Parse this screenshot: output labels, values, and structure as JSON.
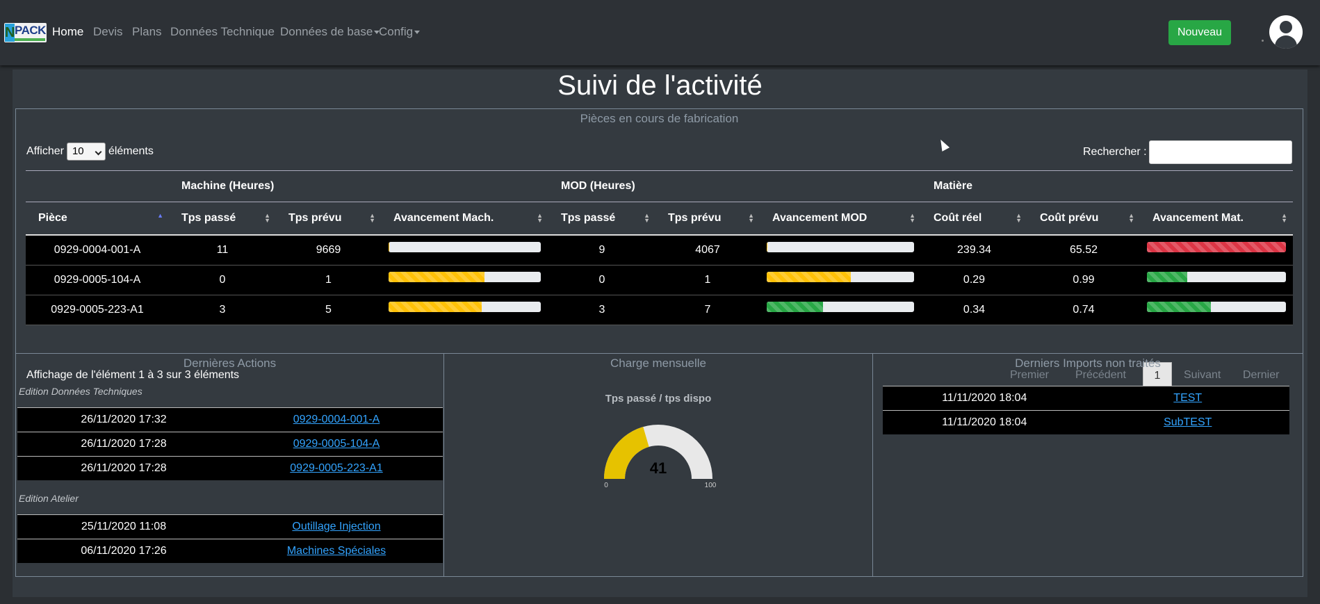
{
  "nav": {
    "logo_text": "PACK",
    "logo_letter": "N",
    "items": [
      {
        "label": "Home",
        "active": true
      },
      {
        "label": "Devis"
      },
      {
        "label": "Plans"
      },
      {
        "label": "Données Technique"
      },
      {
        "label": "Données de base",
        "dropdown": true
      },
      {
        "label": "Config",
        "dropdown": true
      }
    ],
    "new_button": "Nouveau",
    "avatar_icon": "user-circle-icon"
  },
  "page_title": "Suivi de l'activité",
  "pieces": {
    "title": "Pièces en cours de fabrication",
    "show_prefix": "Afficher",
    "show_value": "10",
    "show_suffix": "éléments",
    "search_label": "Rechercher :",
    "search_value": "",
    "groups": [
      "Machine (Heures)",
      "MOD (Heures)",
      "Matière"
    ],
    "columns": [
      "Pièce",
      "Tps passé",
      "Tps prévu",
      "Avancement Mach.",
      "Tps passé",
      "Tps prévu",
      "Avancement MOD",
      "Coût réel",
      "Coût prévu",
      "Avancement Mat."
    ],
    "rows": [
      {
        "piece": "0929-0004-001-A",
        "mach_passe": "11",
        "mach_prevu": "9669",
        "mach_pct": 0.11,
        "mod_passe": "9",
        "mod_prevu": "4067",
        "mod_pct": 0.22,
        "cout_reel": "239.34",
        "cout_prevu": "65.52",
        "mat_pct": 100
      },
      {
        "piece": "0929-0005-104-A",
        "mach_passe": "0",
        "mach_prevu": "1",
        "mach_pct": 63,
        "mod_passe": "0",
        "mod_prevu": "1",
        "mod_pct": 57,
        "cout_reel": "0.29",
        "cout_prevu": "0.99",
        "mat_pct": 29
      },
      {
        "piece": "0929-0005-223-A1",
        "mach_passe": "3",
        "mach_prevu": "5",
        "mach_pct": 61,
        "mod_passe": "3",
        "mod_prevu": "7",
        "mod_pct": 38,
        "cout_reel": "0.34",
        "cout_prevu": "0.74",
        "mat_pct": 46
      }
    ],
    "info": "Affichage de l'élément 1 à 3 sur 3 éléments",
    "pagination": {
      "first": "Premier",
      "prev": "Précédent",
      "current": "1",
      "next": "Suivant",
      "last": "Dernier"
    }
  },
  "actions": {
    "title": "Dernières Actions",
    "sections": [
      {
        "name": "Edition Données Techniques",
        "rows": [
          {
            "date": "26/11/2020 17:32",
            "link": "0929-0004-001-A"
          },
          {
            "date": "26/11/2020 17:28",
            "link": "0929-0005-104-A"
          },
          {
            "date": "26/11/2020 17:28",
            "link": "0929-0005-223-A1"
          }
        ]
      },
      {
        "name": "Edition Atelier",
        "rows": [
          {
            "date": "25/11/2020 11:08",
            "link": "Outillage Injection"
          },
          {
            "date": "06/11/2020 17:26",
            "link": "Machines Spéciales"
          }
        ]
      }
    ]
  },
  "charge": {
    "title": "Charge mensuelle",
    "gauge_title": "Tps passé / tps dispo",
    "value": 41,
    "min": "0",
    "max": "100",
    "fill_color": "#e6c200",
    "track_color": "#e8e8e8"
  },
  "imports": {
    "title": "Derniers Imports non traités",
    "rows": [
      {
        "date": "11/11/2020 18:04",
        "link": "TEST"
      },
      {
        "date": "11/11/2020 18:04",
        "link": "SubTEST"
      }
    ]
  },
  "colors": {
    "accent_green": "#28a745",
    "bar_yellow": "#ffc107",
    "bar_green": "#28a745",
    "bar_red": "#dc3545",
    "link": "#33a4ff"
  }
}
